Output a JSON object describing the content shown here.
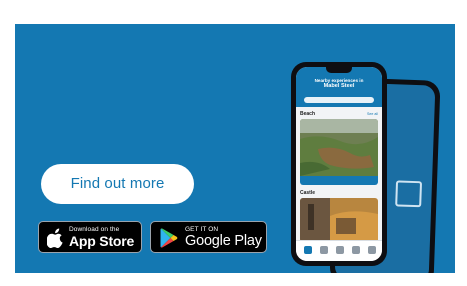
{
  "cta": {
    "label": "Find out more"
  },
  "badges": {
    "apple": {
      "small": "Download on the",
      "large": "App Store"
    },
    "google": {
      "small": "GET IT ON",
      "large": "Google Play"
    }
  },
  "app": {
    "title_line1": "Nearby experiences in",
    "title_line2": "Mabel Steel",
    "section1": "Beach",
    "section2": "Castle",
    "see_all": "See all",
    "card1_caption": "",
    "card2_caption": ""
  },
  "icons": {
    "apple": "apple-logo-icon",
    "google": "google-play-logo-icon",
    "tab1": "home-icon",
    "tab2": "map-icon",
    "tab3": "calendar-icon",
    "tab4": "bookmark-icon",
    "tab5": "profile-icon"
  },
  "colors": {
    "brand_blue": "#1478b2",
    "badge_black": "#000000",
    "cta_text": "#1478b2"
  }
}
